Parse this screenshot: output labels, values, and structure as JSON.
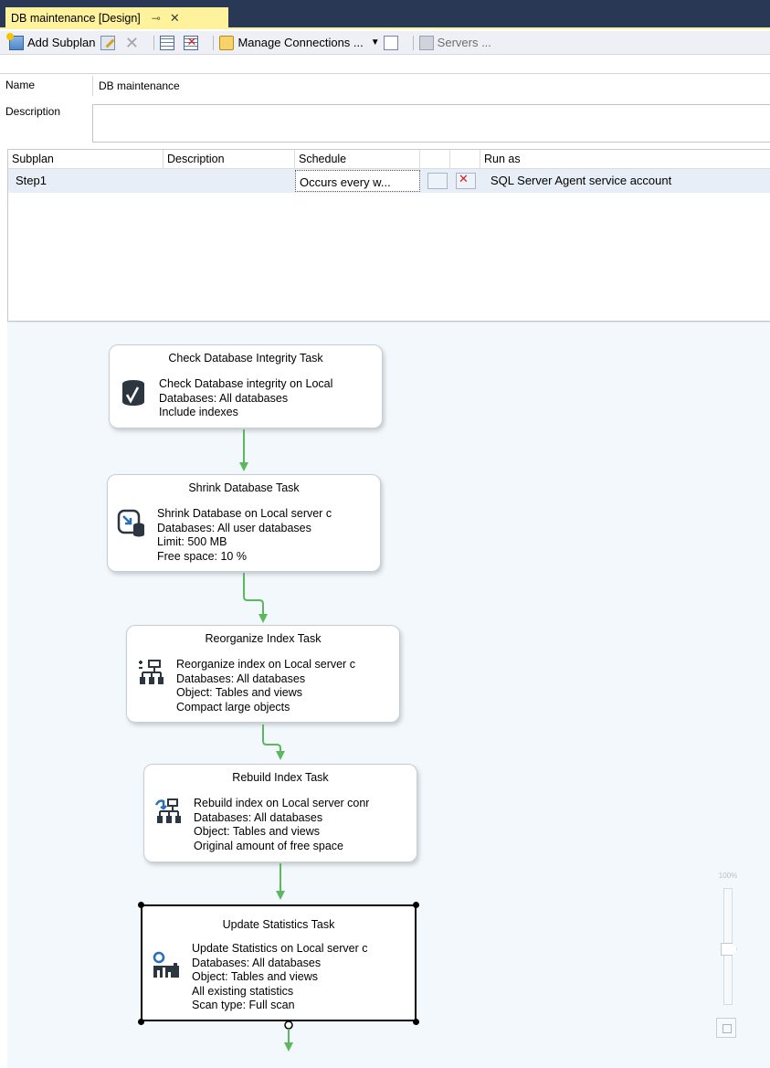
{
  "tab": {
    "title": "DB maintenance [Design]",
    "pin_glyph": "⊸",
    "close_glyph": "✕"
  },
  "toolbar": {
    "add_subplan": "Add Subplan",
    "manage_connections": "Manage Connections ...",
    "servers": "Servers ..."
  },
  "properties": {
    "name_label": "Name",
    "name_value": "DB maintenance",
    "description_label": "Description",
    "description_value": ""
  },
  "subplans": {
    "columns": [
      "Subplan",
      "Description",
      "Schedule",
      "",
      "",
      "Run as"
    ],
    "rows": [
      {
        "subplan": "Step1",
        "description": "",
        "schedule": "Occurs every w...",
        "run_as": "SQL Server Agent service account"
      }
    ]
  },
  "tasks": [
    {
      "title": "Check Database Integrity Task",
      "lines": [
        "Check Database integrity on Local",
        "Databases: All databases",
        "Include indexes"
      ],
      "icon": "database-check-icon"
    },
    {
      "title": "Shrink Database Task",
      "lines": [
        "Shrink Database on Local server c",
        "Databases: All user databases",
        "Limit: 500 MB",
        "Free space: 10 %"
      ],
      "icon": "shrink-database-icon"
    },
    {
      "title": "Reorganize Index Task",
      "lines": [
        "Reorganize index on Local server c",
        "Databases: All databases",
        "Object: Tables and views",
        "Compact large objects"
      ],
      "icon": "reorganize-index-icon"
    },
    {
      "title": "Rebuild Index Task",
      "lines": [
        "Rebuild index on Local server conr",
        "Databases: All databases",
        "Object: Tables and views",
        "Original amount of free space"
      ],
      "icon": "rebuild-index-icon"
    },
    {
      "title": "Update Statistics Task",
      "lines": [
        "Update Statistics on Local server c",
        "Databases: All databases",
        "Object: Tables and views",
        "All existing statistics",
        "Scan type: Full scan"
      ],
      "icon": "update-statistics-icon"
    }
  ],
  "zoom": {
    "label": "100%"
  },
  "colors": {
    "tab_bg": "#fff29d",
    "frame_bg": "#293955",
    "connector": "#5cb85c",
    "designer_bg": "#f2f8fb"
  }
}
